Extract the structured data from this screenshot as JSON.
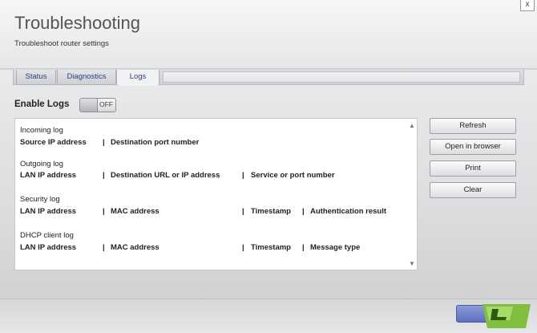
{
  "window": {
    "title": "Troubleshooting",
    "subtitle": "Troubleshoot router settings",
    "close_label": "x"
  },
  "tabs": [
    {
      "label": "Status",
      "active": false
    },
    {
      "label": "Diagnostics",
      "active": false
    },
    {
      "label": "Logs",
      "active": true
    }
  ],
  "enable_logs": {
    "label": "Enable Logs",
    "state": "OFF"
  },
  "logs": [
    {
      "title": "Incoming log",
      "columns": [
        "Source IP address",
        "|",
        "Destination port number"
      ]
    },
    {
      "title": "Outgoing log",
      "columns": [
        "LAN IP address",
        "|",
        "Destination URL or IP address",
        "|",
        "Service or port number"
      ]
    },
    {
      "title": "Security log",
      "columns": [
        "LAN IP address",
        "|",
        "MAC address",
        "|",
        "Timestamp",
        "|",
        "Authentication result"
      ]
    },
    {
      "title": "DHCP client log",
      "columns": [
        "LAN IP address",
        "|",
        "MAC address",
        "|",
        "Timestamp",
        "|",
        "Message type"
      ]
    }
  ],
  "actions": {
    "refresh": "Refresh",
    "open_in_browser": "Open in browser",
    "print": "Print",
    "clear": "Clear"
  },
  "scrollbar": {
    "up_icon": "chevron-up-icon",
    "down_icon": "chevron-down-icon"
  },
  "colors": {
    "tab_text": "#2f3f86",
    "footer_button": "#6b7cc7",
    "logo_green": "#79b93a"
  }
}
